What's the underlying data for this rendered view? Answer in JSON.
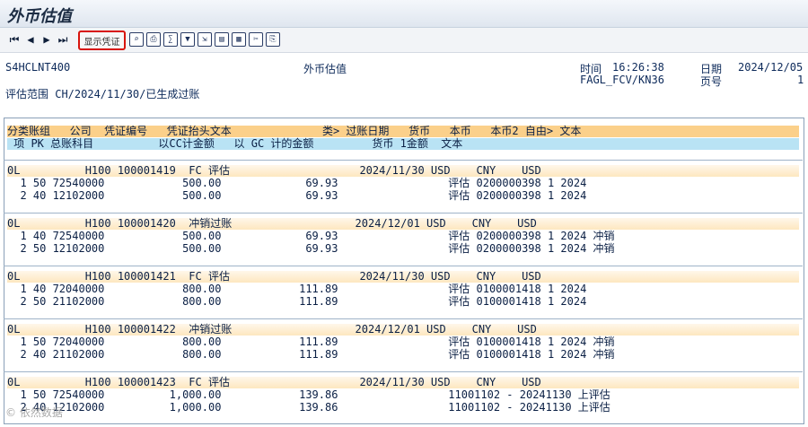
{
  "window": {
    "title": "外币估值"
  },
  "toolbar": {
    "show_doc_label": "显示凭证",
    "nav": [
      {
        "glyph": "⏮",
        "name": "first-page-icon"
      },
      {
        "glyph": "◀",
        "name": "prev-page-icon"
      },
      {
        "glyph": "▶",
        "name": "next-page-icon"
      },
      {
        "glyph": "⏭",
        "name": "last-page-icon"
      }
    ],
    "tools": [
      {
        "glyph": "⌕",
        "name": "details-icon"
      },
      {
        "glyph": "⎙",
        "name": "print-icon"
      },
      {
        "glyph": "∑",
        "name": "total-icon"
      },
      {
        "glyph": "▼",
        "name": "filter-icon"
      },
      {
        "glyph": "⇲",
        "name": "export-icon"
      },
      {
        "glyph": "▤",
        "name": "layout-icon"
      },
      {
        "glyph": "▦",
        "name": "select-layout-icon"
      },
      {
        "glyph": "✂",
        "name": "cut-icon"
      },
      {
        "glyph": "⎘",
        "name": "copy-icon"
      }
    ]
  },
  "header": {
    "client": "S4HCLNT400",
    "report_title": "外币估值",
    "time_label": "时间",
    "time": "16:26:38",
    "tcode": "FAGL_FCV/KN36",
    "date_label": "日期",
    "date": "2024/12/05",
    "page_label": "页号",
    "page": "1",
    "scope": "评估范围 CH/2024/11/30/已生成过账"
  },
  "columns": {
    "row1": "分类账组   公司  凭证编号   凭证抬头文本              类> 过账日期   货币   本币   本币2 自由> 文本",
    "row2": " 项 PK 总账科目          以CC计金额   以 GC 计的金额         货币 1金额  文本"
  },
  "groups": [
    {
      "header": "0L          H100 100001419  FC 评估                    2024/11/30 USD    CNY    USD",
      "lines": [
        "  1 50 72540000            500.00             69.93                 评估 0200000398 1 2024",
        "  2 40 12102000            500.00             69.93                 评估 0200000398 1 2024"
      ]
    },
    {
      "header": "0L          H100 100001420  冲销过账                   2024/12/01 USD    CNY    USD",
      "lines": [
        "  1 40 72540000            500.00             69.93                 评估 0200000398 1 2024 冲销",
        "  2 50 12102000            500.00             69.93                 评估 0200000398 1 2024 冲销"
      ]
    },
    {
      "header": "0L          H100 100001421  FC 评估                    2024/11/30 USD    CNY    USD",
      "lines": [
        "  1 40 72040000            800.00            111.89                 评估 0100001418 1 2024",
        "  2 50 21102000            800.00            111.89                 评估 0100001418 1 2024"
      ]
    },
    {
      "header": "0L          H100 100001422  冲销过账                   2024/12/01 USD    CNY    USD",
      "lines": [
        "  1 50 72040000            800.00            111.89                 评估 0100001418 1 2024 冲销",
        "  2 40 21102000            800.00            111.89                 评估 0100001418 1 2024 冲销"
      ]
    },
    {
      "header": "0L          H100 100001423  FC 评估                    2024/11/30 USD    CNY    USD",
      "lines": [
        "  1 50 72540000          1,000.00            139.86                 11001102 - 20241130 上评估",
        "  2 40 12102000          1,000.00            139.86                 11001102 - 20241130 上评估"
      ]
    }
  ],
  "watermark": "© 依然数据"
}
